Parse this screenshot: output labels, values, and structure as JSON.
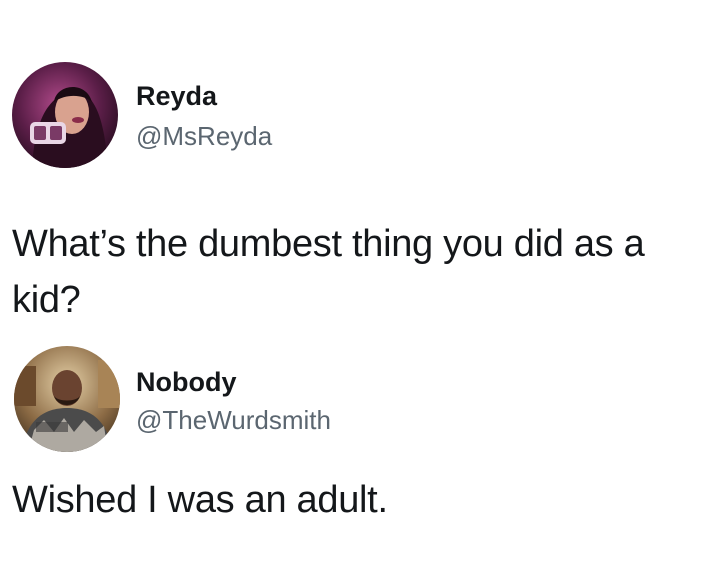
{
  "tweets": [
    {
      "author": {
        "name": "Reyda",
        "handle": "@MsReyda",
        "avatar": "profile-photo-woman"
      },
      "text": "What’s the dumbest thing you did as a kid?"
    },
    {
      "author": {
        "name": "Nobody",
        "handle": "@TheWurdsmith",
        "avatar": "profile-photo-man"
      },
      "text": "Wished I was an adult."
    }
  ],
  "colors": {
    "text": "#14171a",
    "handle": "#5b6670",
    "background": "#ffffff"
  }
}
